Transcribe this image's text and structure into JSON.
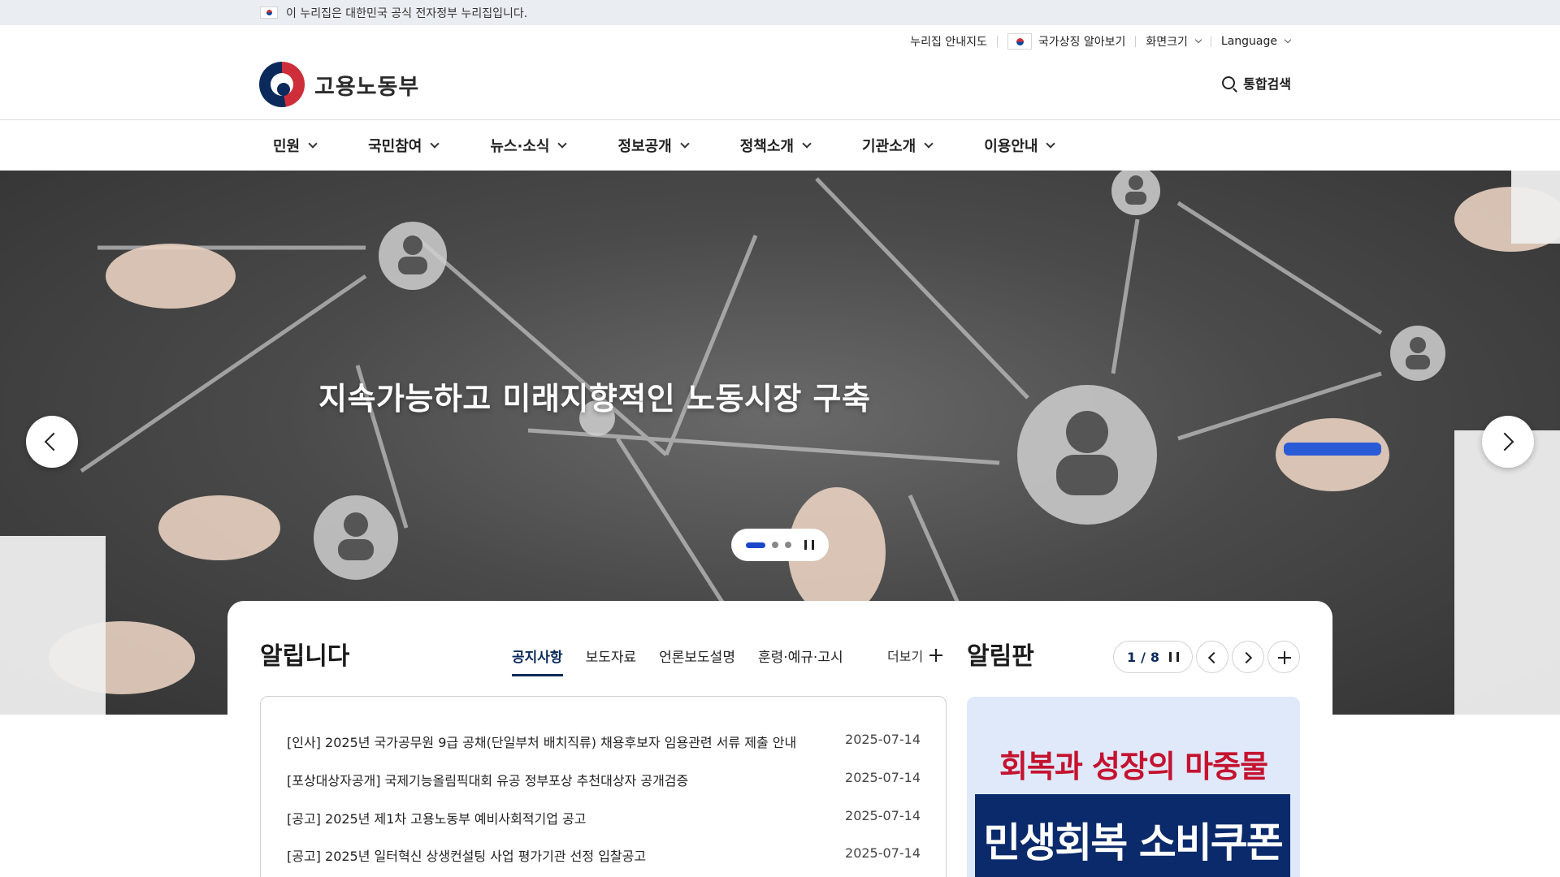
{
  "gov_banner": {
    "text": "이 누리집은 대한민국 공식 전자정부 누리집입니다."
  },
  "utility": {
    "sitemap": "누리집 안내지도",
    "symbols": "국가상징 알아보기",
    "font_size": "화면크기",
    "language": "Language"
  },
  "header": {
    "logo_text": "고용노동부",
    "search_label": "통합검색"
  },
  "nav": {
    "items": [
      {
        "label": "민원"
      },
      {
        "label": "국민참여"
      },
      {
        "label": "뉴스·소식"
      },
      {
        "label": "정보공개"
      },
      {
        "label": "정책소개"
      },
      {
        "label": "기관소개"
      },
      {
        "label": "이용안내"
      }
    ]
  },
  "hero": {
    "title": "지속가능하고 미래지향적인 노동시장 구축",
    "slides_total": 3,
    "slide_current": 1
  },
  "notices": {
    "title": "알립니다",
    "tabs": [
      {
        "label": "공지사항",
        "active": true
      },
      {
        "label": "보도자료",
        "active": false
      },
      {
        "label": "언론보도설명",
        "active": false
      },
      {
        "label": "훈령·예규·고시",
        "active": false
      }
    ],
    "more_label": "더보기",
    "items": [
      {
        "title": "[인사] 2025년 국가공무원 9급 공채(단일부처 배치직류) 채용후보자 임용관련 서류 제출 안내",
        "date": "2025-07-14"
      },
      {
        "title": "[포상대상자공개] 국제기능올림픽대회 유공 정부포상 추천대상자 공개검증",
        "date": "2025-07-14"
      },
      {
        "title": "[공고] 2025년 제1차 고용노동부 예비사회적기업 공고",
        "date": "2025-07-14"
      },
      {
        "title": "[공고] 2025년 일터혁신 상생컨설팅 사업 평가기관 선정 입찰공고",
        "date": "2025-07-14"
      }
    ]
  },
  "board": {
    "title": "알림판",
    "current": "1",
    "slash": "/",
    "total": "8",
    "banner_line1": "회복과 성장의 마중물",
    "banner_line2": "민생회복 소비쿠폰"
  },
  "colors": {
    "primary_navy": "#0b2a5b",
    "pager_active": "#1a47c9",
    "banner_red": "#c4122f"
  }
}
